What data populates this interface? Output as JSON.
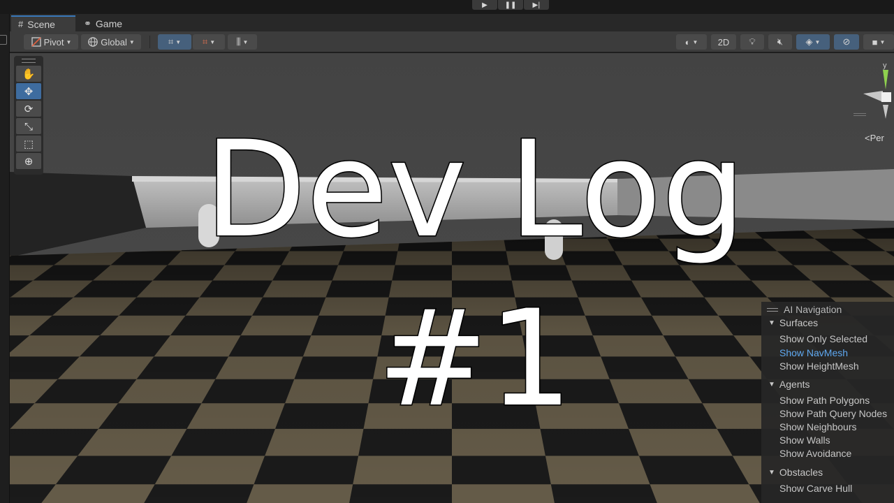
{
  "playbar": {
    "icons": [
      "play-icon",
      "pause-icon",
      "step-icon"
    ],
    "glyphs": [
      "▶",
      "❚❚",
      "▶|"
    ]
  },
  "tabs": [
    {
      "label": "Scene",
      "icon": "grid-icon",
      "glyph": "#"
    },
    {
      "label": "Game",
      "icon": "gamepad-icon",
      "glyph": "⚭"
    }
  ],
  "toolbar": {
    "pivot_label": "Pivot",
    "global_label": "Global",
    "mode_2d_label": "2D"
  },
  "tools": [
    {
      "name": "hand-tool",
      "glyph": "✋"
    },
    {
      "name": "move-tool",
      "glyph": "✥"
    },
    {
      "name": "rotate-tool",
      "glyph": "⟳"
    },
    {
      "name": "scale-tool",
      "glyph": "⤡"
    },
    {
      "name": "rect-tool",
      "glyph": "⬚"
    },
    {
      "name": "transform-tool",
      "glyph": "⊕"
    }
  ],
  "gizmo": {
    "axis_label": "y",
    "projection_label": "<Per"
  },
  "ai_navigation": {
    "title": "AI Navigation",
    "surfaces": {
      "heading": "Surfaces",
      "options": [
        "Show Only Selected",
        "Show NavMesh",
        "Show HeightMesh"
      ]
    },
    "agents": {
      "heading": "Agents",
      "options": [
        "Show Path Polygons",
        "Show Path Query Nodes",
        "Show Neighbours",
        "Show Walls",
        "Show Avoidance"
      ]
    },
    "obstacles": {
      "heading": "Obstacles",
      "options": [
        "Show Carve Hull"
      ]
    },
    "active_option": "Show NavMesh"
  },
  "title_overlay": {
    "line1": "Dev Log",
    "line2": "#1"
  },
  "colors": {
    "accent": "#3a79bb",
    "active_option": "#5fa8f0",
    "viewport_sky": "#474747"
  }
}
